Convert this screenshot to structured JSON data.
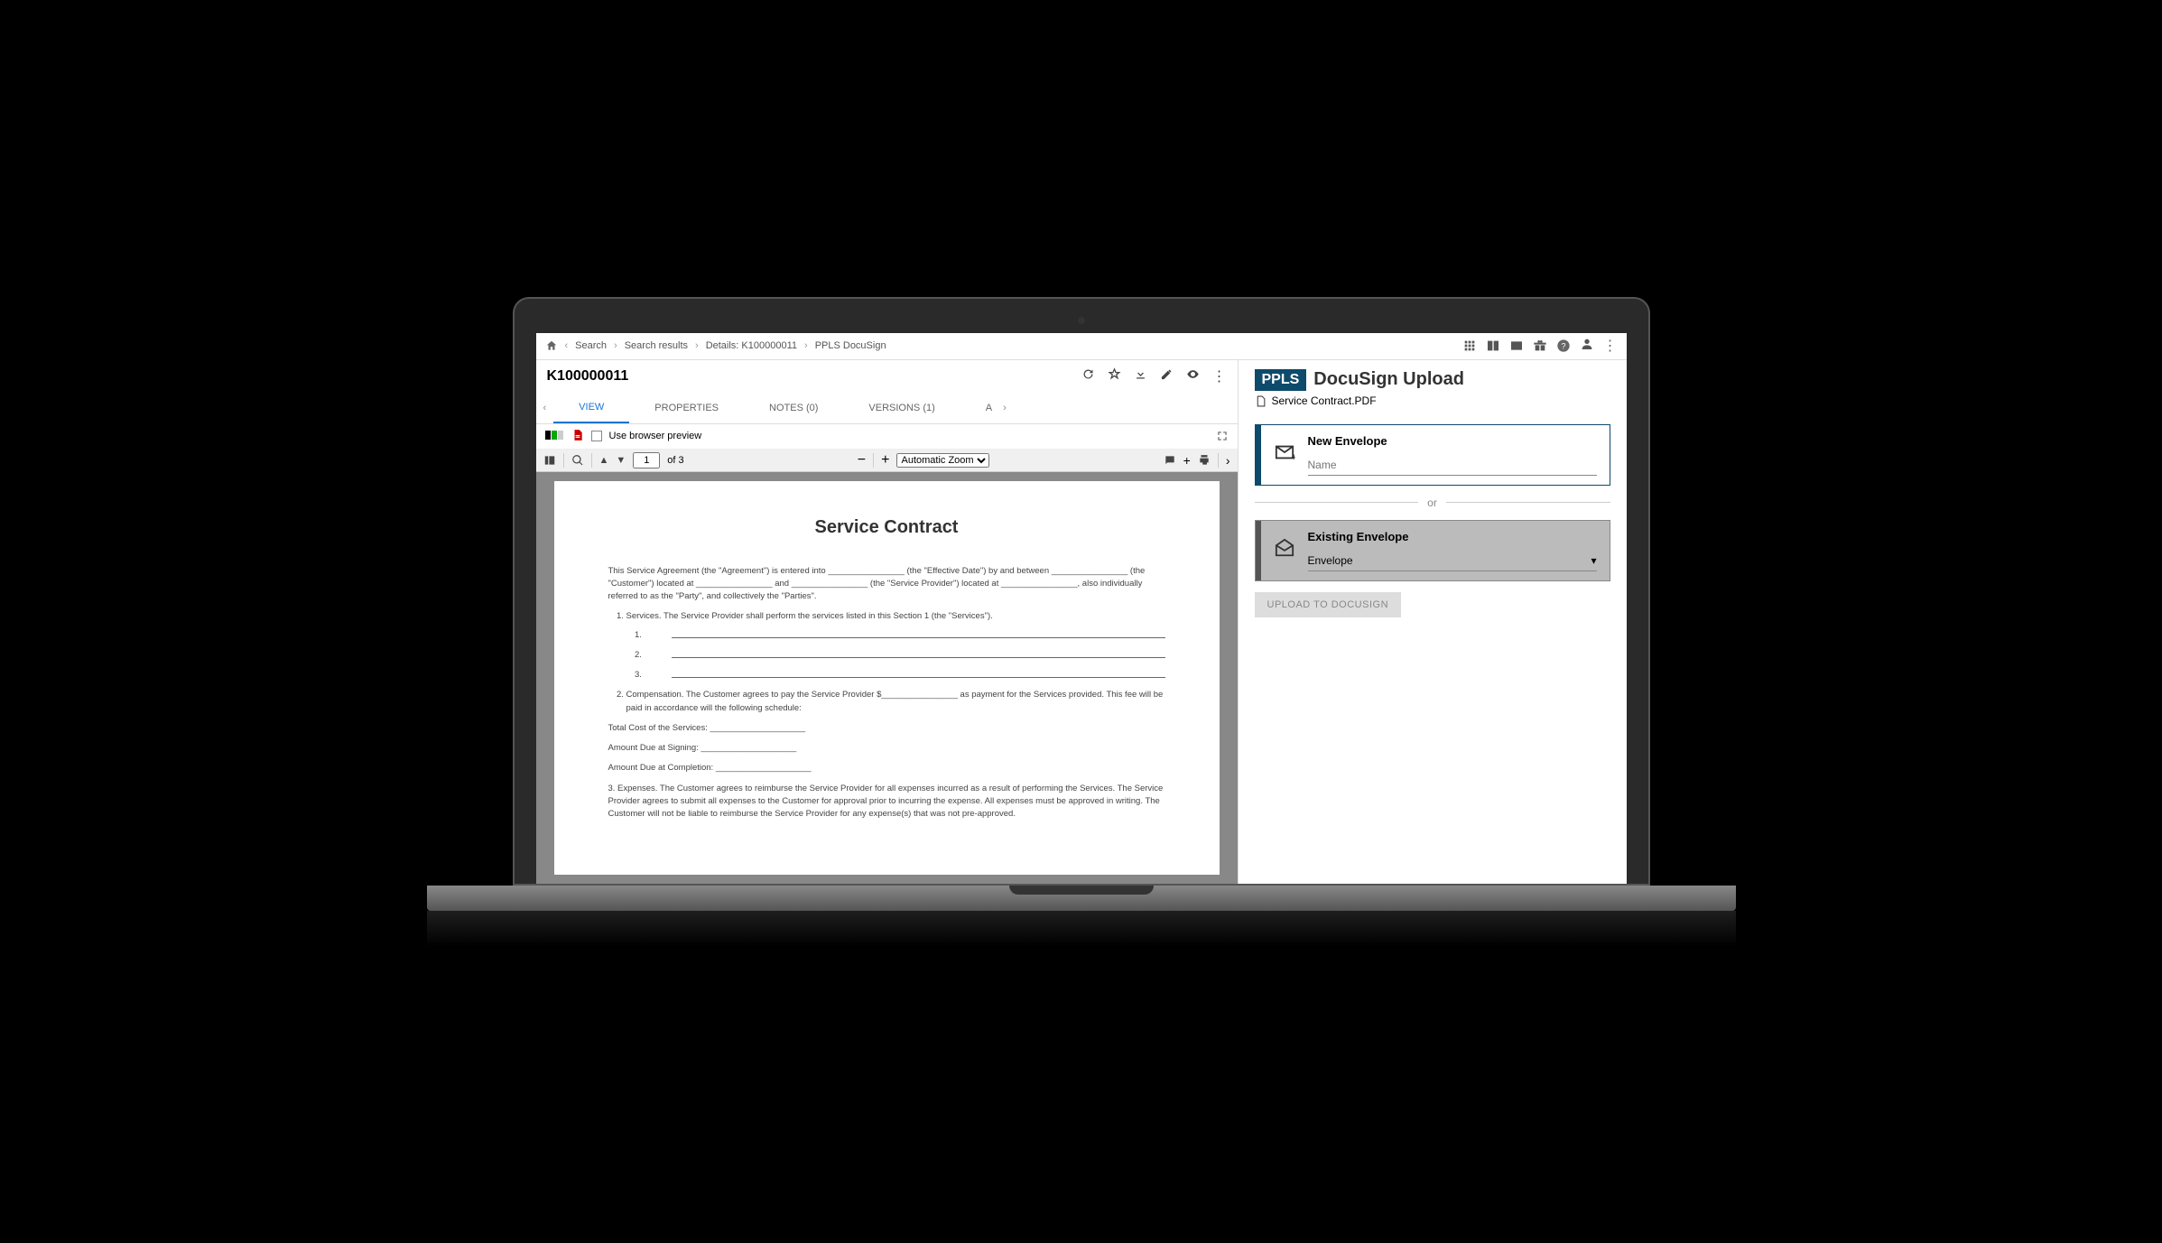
{
  "breadcrumbs": [
    "Search",
    "Search results",
    "Details: K100000011",
    "PPLS DocuSign"
  ],
  "doc_title": "K100000011",
  "tabs": {
    "view": "VIEW",
    "properties": "PROPERTIES",
    "notes": "NOTES (0)",
    "versions": "VERSIONS (1)",
    "partial": "A"
  },
  "preview_bar": {
    "use_browser_preview": "Use browser preview"
  },
  "pdf_toolbar": {
    "page": "1",
    "of": "of 3",
    "zoom": "Automatic Zoom"
  },
  "pdf_doc": {
    "title": "Service Contract",
    "intro": "This Service Agreement (the \"Agreement\") is entered into ________________ (the \"Effective Date\") by and between ________________ (the \"Customer\") located at ________________ and ________________ (the \"Service Provider\") located at ________________, also individually referred to as the \"Party\", and collectively the \"Parties\".",
    "item1": "Services. The Service Provider shall perform the services listed in this Section 1 (the \"Services\").",
    "item2": "Compensation. The Customer agrees to pay the Service Provider $________________ as payment for the Services provided. This fee will be paid in accordance will the following schedule:",
    "cost_line": "Total Cost of the Services: ____________________",
    "signing_line": "Amount Due at Signing: ____________________",
    "completion_line": "Amount Due at Completion: ____________________",
    "item3": "3.       Expenses. The Customer agrees to reimburse the Service Provider for all expenses incurred as a result of performing the Services. The Service Provider agrees to submit all expenses to the Customer for approval prior to incurring the expense. All expenses must be approved in writing. The Customer will not be liable to reimburse the Service Provider for any expense(s) that was not pre-approved."
  },
  "right": {
    "badge": "PPLS",
    "title": "DocuSign Upload",
    "file": "Service Contract.PDF",
    "new_envelope": "New Envelope",
    "name_placeholder": "Name",
    "or": "or",
    "existing_envelope": "Existing Envelope",
    "envelope_placeholder": "Envelope",
    "upload_btn": "UPLOAD TO DOCUSIGN"
  }
}
